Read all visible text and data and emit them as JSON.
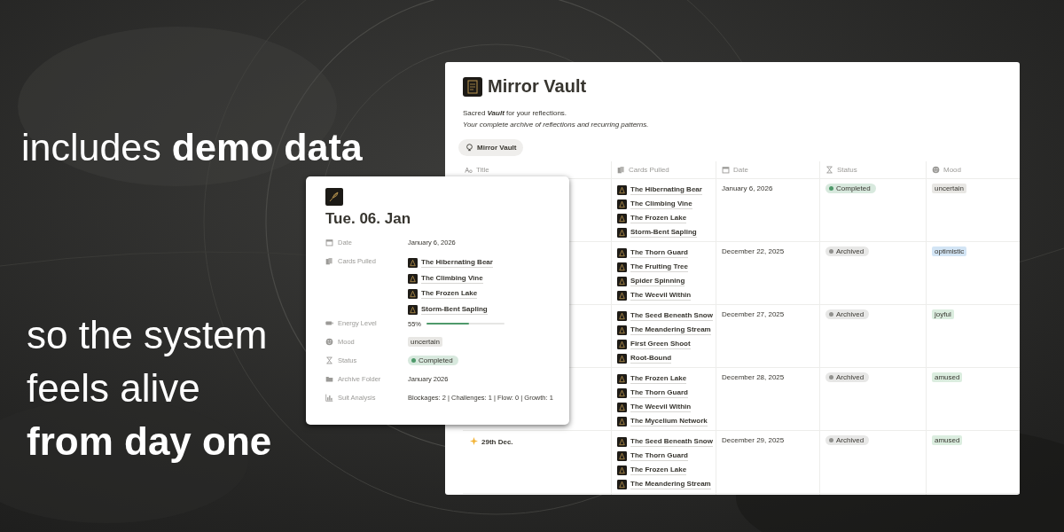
{
  "headline": {
    "top": "includes **demo data**",
    "bottom": "so the system\nfeels alive\n**from day one**"
  },
  "window": {
    "title": "Mirror Vault",
    "description": "Sacred **Vault** for your reflections.",
    "subtitle": "Your complete archive of reflections and recurring patterns.",
    "view_tab": {
      "label": "Mirror Vault",
      "selected": true
    },
    "columns": [
      {
        "label": "Title",
        "kind": "title"
      },
      {
        "label": "Cards Pulled",
        "kind": "relation"
      },
      {
        "label": "Date",
        "kind": "date"
      },
      {
        "label": "Status",
        "kind": "status"
      },
      {
        "label": "Mood",
        "kind": "select"
      }
    ],
    "rows": [
      {
        "cards": [
          "The Hibernating Bear",
          "The Climbing Vine",
          "The Frozen Lake",
          "Storm-Bent Sapling"
        ],
        "date": "January 6, 2026",
        "status": {
          "label": "Completed",
          "color": "#4f9a6b"
        },
        "mood": {
          "label": "uncertain",
          "color": "#e8e7e4"
        }
      },
      {
        "cards": [
          "The Thorn Guard",
          "The Fruiting Tree",
          "Spider Spinning",
          "The Weevil Within"
        ],
        "date": "December 22, 2025",
        "status": {
          "label": "Archived",
          "color": "#91918e"
        },
        "mood": {
          "label": "optimistic",
          "color": "#d3e5f5"
        }
      },
      {
        "cards": [
          "The Seed Beneath Snow",
          "The Meandering Stream",
          "First Green Shoot",
          "Root-Bound"
        ],
        "date": "December 27, 2025",
        "status": {
          "label": "Archived",
          "color": "#91918e"
        },
        "mood": {
          "label": "joyful",
          "color": "#dbeddf"
        }
      },
      {
        "cards": [
          "The Frozen Lake",
          "The Thorn Guard",
          "The Weevil Within",
          "The Mycelium Network"
        ],
        "date": "December 28, 2025",
        "status": {
          "label": "Archived",
          "color": "#91918e"
        },
        "mood": {
          "label": "amused",
          "color": "#dbeddf"
        }
      },
      {
        "title": "29th Dec.",
        "cards": [
          "The Seed Beneath Snow",
          "The Thorn Guard",
          "The Frozen Lake",
          "The Meandering Stream"
        ],
        "date": "December 29, 2025",
        "status": {
          "label": "Archived",
          "color": "#91918e"
        },
        "mood": {
          "label": "amused",
          "color": "#dbeddf"
        }
      }
    ]
  },
  "entry_card": {
    "title": "Tue. 06. Jan",
    "properties": [
      {
        "kind": "date",
        "label": "Date",
        "value": "January 6, 2026"
      },
      {
        "kind": "relation",
        "label": "Cards Pulled",
        "cards": [
          "The Hibernating Bear",
          "The Climbing Vine",
          "The Frozen Lake",
          "Storm-Bent Sapling"
        ]
      },
      {
        "kind": "progress",
        "label": "Energy Level",
        "value": "55%",
        "level": 0.55
      },
      {
        "kind": "select",
        "label": "Mood",
        "value": "uncertain",
        "color": "#e8e7e4"
      },
      {
        "kind": "status",
        "label": "Status",
        "value": "Completed",
        "color": "#4f9a6b"
      },
      {
        "kind": "folder",
        "label": "Archive Folder",
        "value": "January 2026"
      },
      {
        "kind": "chart",
        "label": "Suit Analysis",
        "value": "Blockages: 2 | Challenges: 1 | Flow: 0 | Growth: 1"
      }
    ]
  }
}
